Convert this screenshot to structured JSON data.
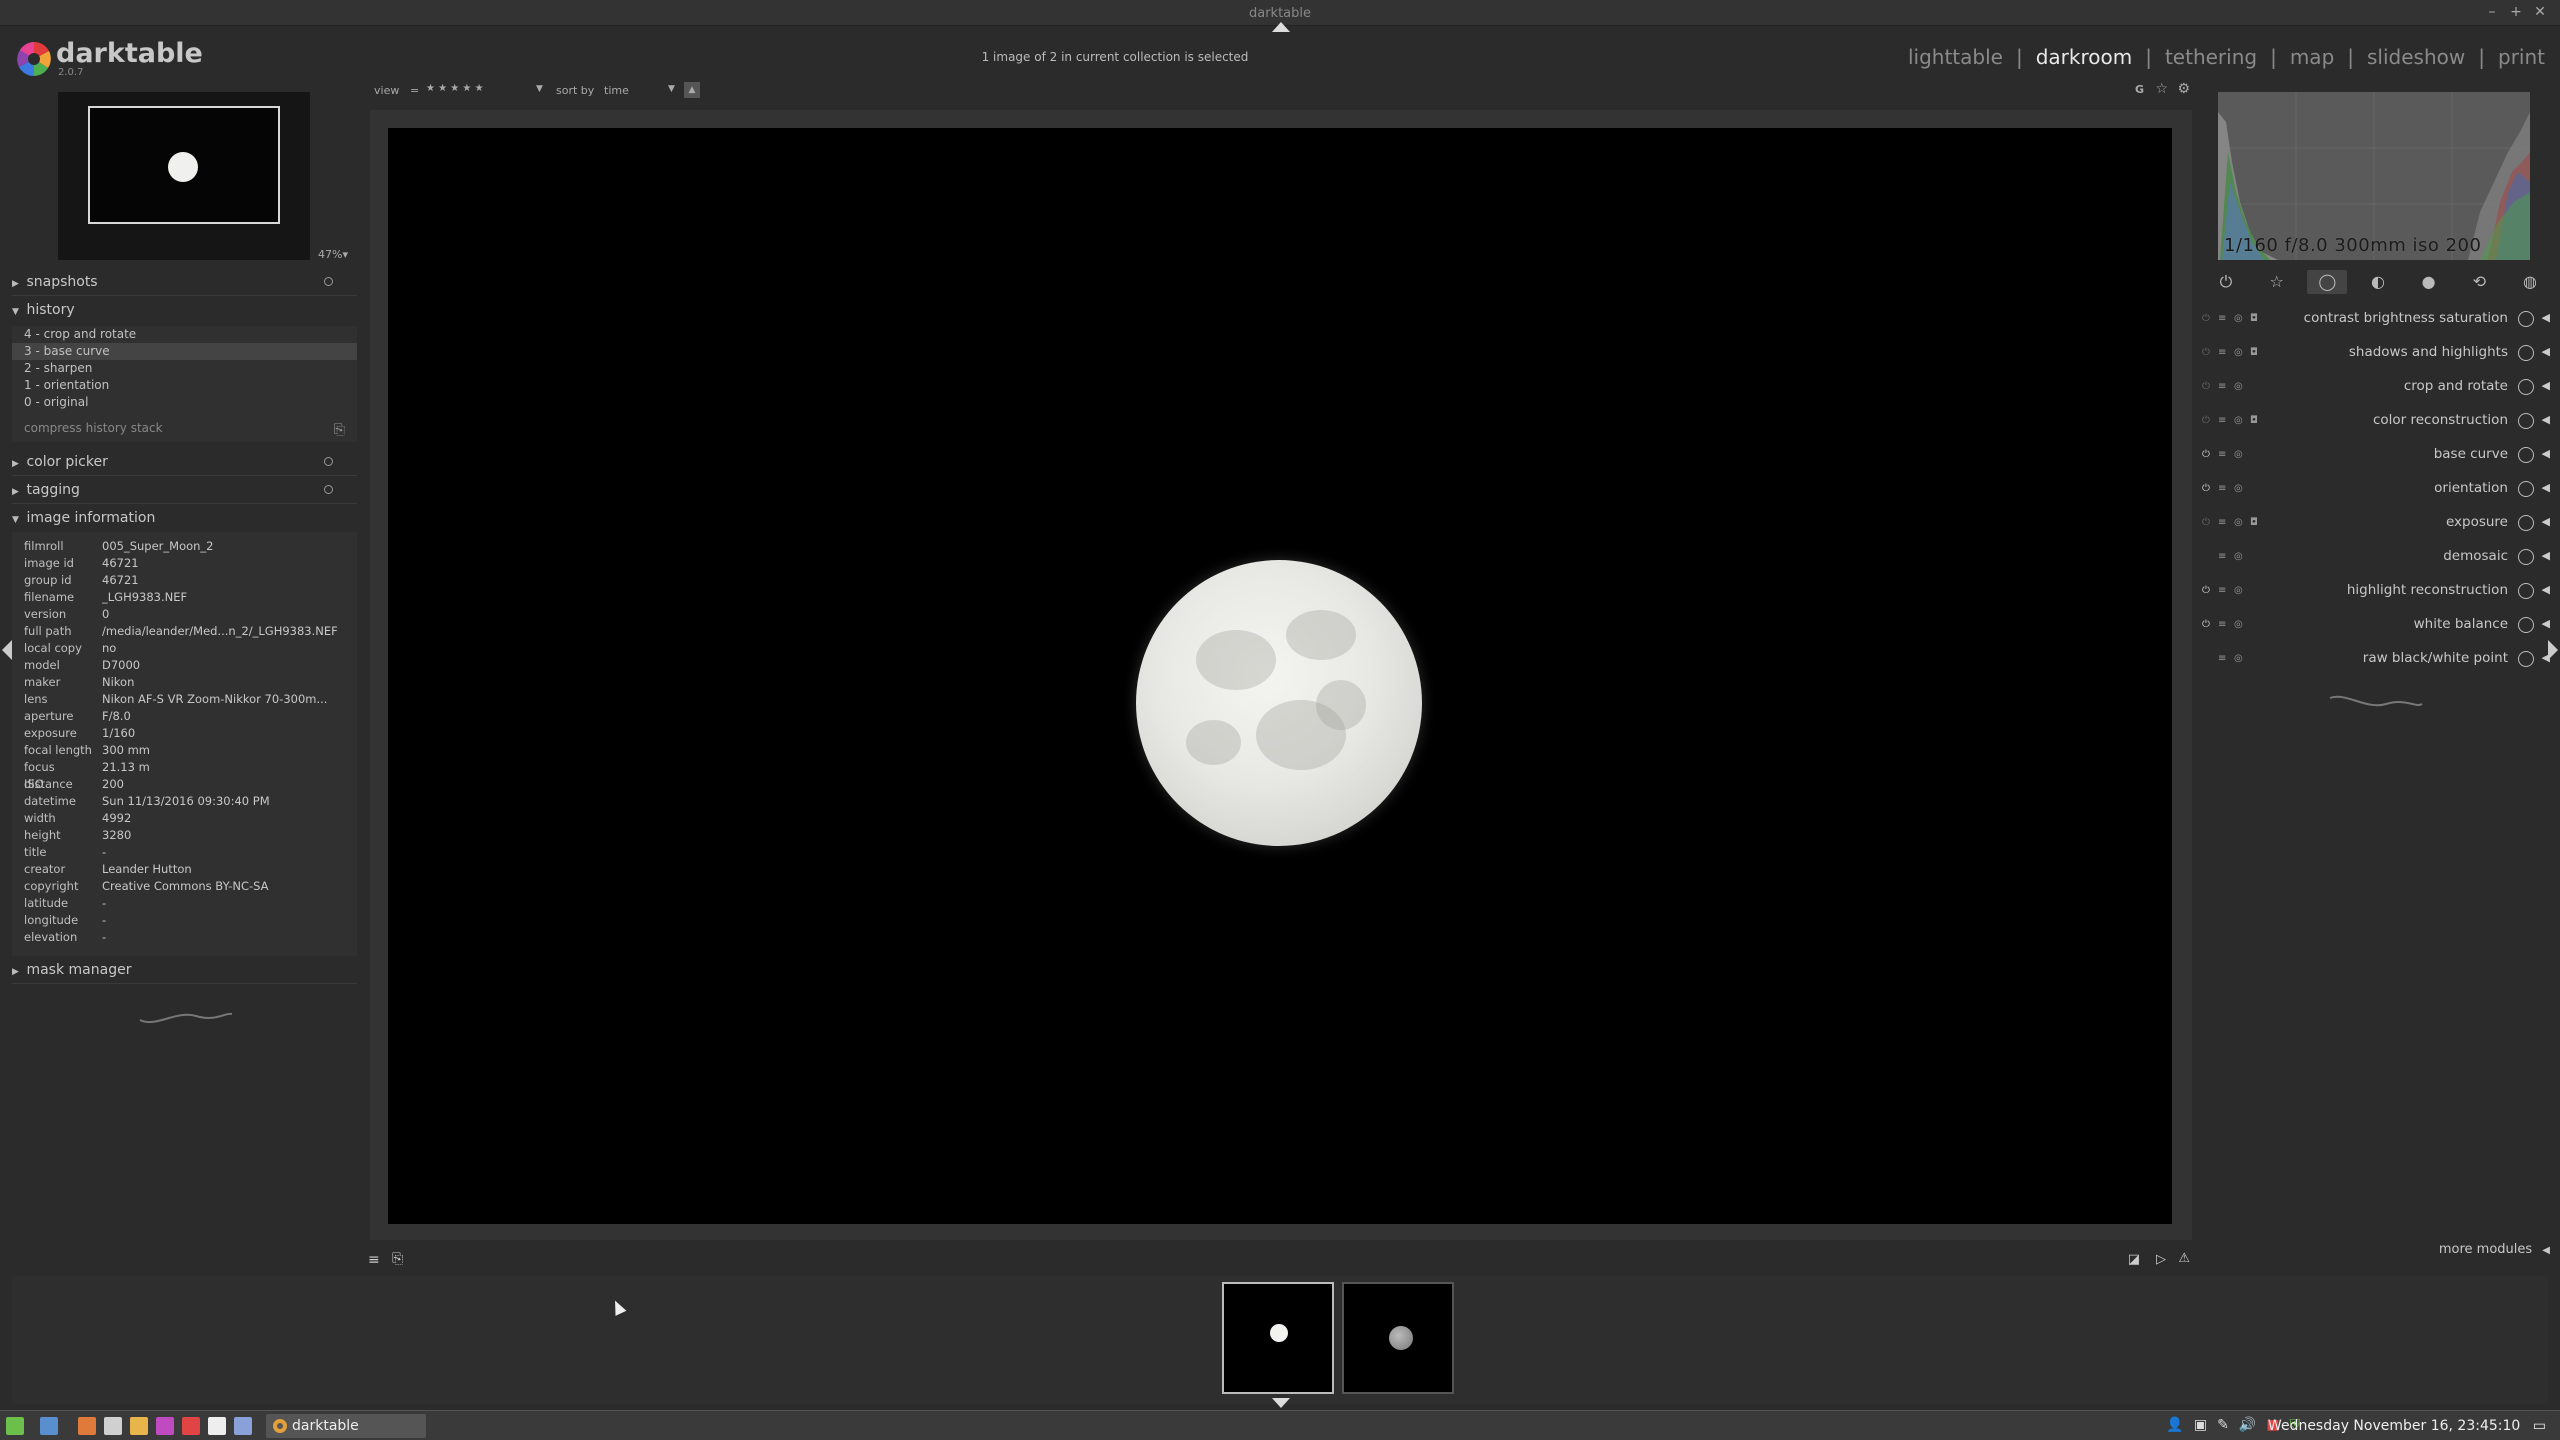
{
  "window": {
    "title": "darktable",
    "controls": [
      "–",
      "+",
      "✕"
    ]
  },
  "app": {
    "name": "darktable",
    "version": "2.0.7"
  },
  "header": {
    "status": "1 image of 2 in current collection is selected",
    "views": [
      "lighttable",
      "darkroom",
      "tethering",
      "map",
      "slideshow",
      "print"
    ],
    "active_view": "darkroom",
    "separator": "|"
  },
  "navigator": {
    "zoom": "47%"
  },
  "left": {
    "snapshots_label": "snapshots",
    "history_label": "history",
    "history_items": [
      "4 - crop and rotate",
      "3 - base curve",
      "2 - sharpen",
      "1 - orientation",
      "0 - original"
    ],
    "history_selected": 1,
    "compress_label": "compress history stack",
    "color_picker_label": "color picker",
    "tagging_label": "tagging",
    "image_info_label": "image information",
    "mask_manager_label": "mask manager",
    "image_info": [
      {
        "k": "filmroll",
        "v": "005_Super_Moon_2"
      },
      {
        "k": "image id",
        "v": "46721"
      },
      {
        "k": "group id",
        "v": "46721"
      },
      {
        "k": "filename",
        "v": "_LGH9383.NEF"
      },
      {
        "k": "version",
        "v": "0"
      },
      {
        "k": "full path",
        "v": "/media/leander/Med...n_2/_LGH9383.NEF"
      },
      {
        "k": "local copy",
        "v": "no"
      },
      {
        "k": "model",
        "v": "D7000"
      },
      {
        "k": "maker",
        "v": "Nikon"
      },
      {
        "k": "lens",
        "v": " Nikon AF-S VR Zoom-Nikkor 70-300m..."
      },
      {
        "k": "aperture",
        "v": "F/8.0"
      },
      {
        "k": "exposure",
        "v": "1/160"
      },
      {
        "k": "focal length",
        "v": "300 mm"
      },
      {
        "k": "focus distance",
        "v": "21.13 m"
      },
      {
        "k": "ISO",
        "v": "200"
      },
      {
        "k": "datetime",
        "v": "Sun 11/13/2016 09:30:40 PM"
      },
      {
        "k": "width",
        "v": "4992"
      },
      {
        "k": "height",
        "v": "3280"
      },
      {
        "k": "title",
        "v": "-"
      },
      {
        "k": "creator",
        "v": "Leander Hutton"
      },
      {
        "k": "copyright",
        "v": "Creative Commons BY-NC-SA"
      },
      {
        "k": "latitude",
        "v": "-"
      },
      {
        "k": "longitude",
        "v": "-"
      },
      {
        "k": "elevation",
        "v": "-"
      }
    ]
  },
  "toolbar_top": {
    "view_label": "view",
    "view_op": "=",
    "stars": "★ ★ ★ ★ ★",
    "sort_label": "sort by",
    "sort_value": "time",
    "right_icons": [
      "G",
      "☆",
      "⚙"
    ]
  },
  "histogram": {
    "info": "1/160 f/8.0 300mm iso 200"
  },
  "module_groups": [
    "⏻",
    "☆",
    "◯",
    "◐",
    "●",
    "⟲",
    "◍"
  ],
  "modules": [
    {
      "label": "contrast brightness saturation",
      "toggle": "off"
    },
    {
      "label": "shadows and highlights",
      "toggle": "off"
    },
    {
      "label": "crop and rotate",
      "toggle": "off"
    },
    {
      "label": "color reconstruction",
      "toggle": "off"
    },
    {
      "label": "base curve",
      "toggle": "on"
    },
    {
      "label": "orientation",
      "toggle": "on"
    },
    {
      "label": "exposure",
      "toggle": "off"
    },
    {
      "label": "demosaic",
      "toggle": "none"
    },
    {
      "label": "highlight reconstruction",
      "toggle": "on"
    },
    {
      "label": "white balance",
      "toggle": "on"
    },
    {
      "label": "raw black/white point",
      "toggle": "none"
    }
  ],
  "more_modules_label": "more modules",
  "taskbar": {
    "app_label": "darktable",
    "clock": "Wednesday November 16, 23:45:10"
  }
}
